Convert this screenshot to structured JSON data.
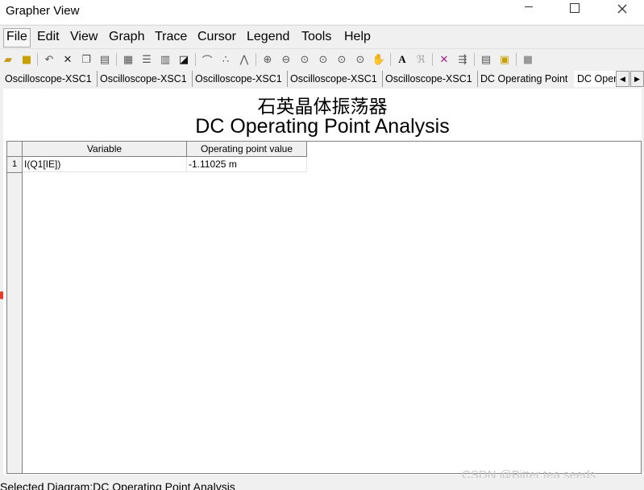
{
  "window": {
    "title": "Grapher View",
    "min_icon": "minimize-icon",
    "max_icon": "maximize-icon",
    "close_icon": "close-icon"
  },
  "menu": [
    "File",
    "Edit",
    "View",
    "Graph",
    "Trace",
    "Cursor",
    "Legend",
    "Tools",
    "Help"
  ],
  "tabs": [
    "Oscilloscope-XSC1",
    "Oscilloscope-XSC1",
    "Oscilloscope-XSC1",
    "Oscilloscope-XSC1",
    "Oscilloscope-XSC1",
    "DC Operating Point",
    "DC Operating Point Analysis"
  ],
  "diagram": {
    "title_cn": "石英晶体振荡器",
    "title": "DC Operating Point Analysis",
    "columns": [
      "Variable",
      "Operating point value"
    ],
    "rows": [
      {
        "num": "1",
        "variable": "I(Q1[IE])",
        "value": "-1.11025 m"
      }
    ]
  },
  "status": "Selected Diagram:DC Operating Point Analysis",
  "watermark": "CSDN @Bitter tea seeds",
  "colors": {
    "marker": "#e23c2a",
    "background": "#f0f0f0"
  }
}
